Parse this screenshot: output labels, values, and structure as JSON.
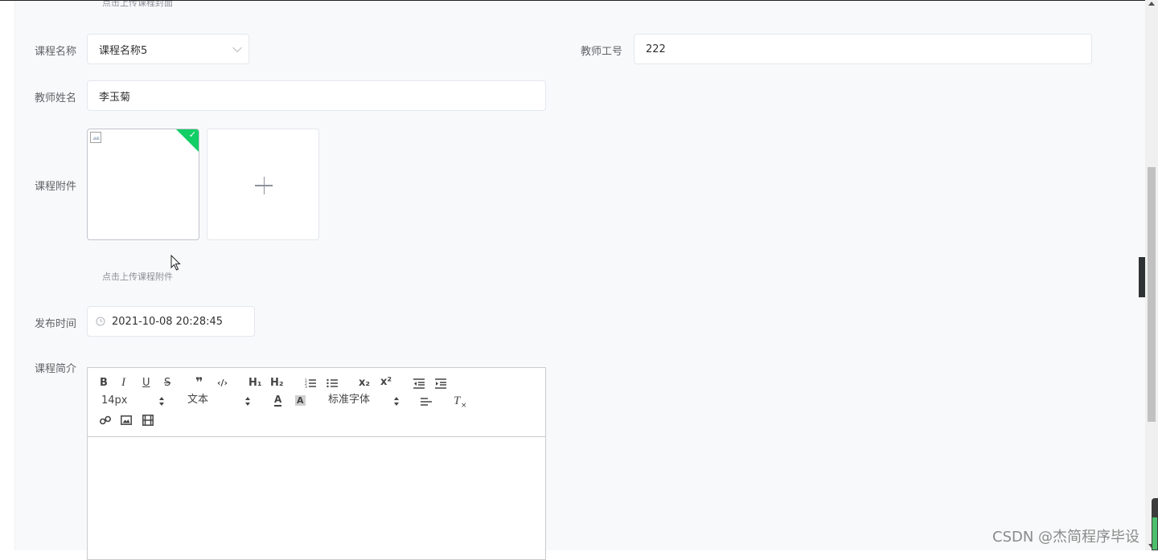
{
  "form": {
    "cover_tip": "点击上传课程封面",
    "course_name": {
      "label": "课程名称",
      "value": "课程名称5"
    },
    "teacher_id": {
      "label": "教师工号",
      "value": "222"
    },
    "teacher_name": {
      "label": "教师姓名",
      "value": "李玉菊"
    },
    "attachment": {
      "label": "课程附件",
      "tip": "点击上传课程附件"
    },
    "publish_time": {
      "label": "发布时间",
      "value": "2021-10-08 20:28:45"
    },
    "intro": {
      "label": "课程简介"
    }
  },
  "editor": {
    "toolbar": {
      "bold": "B",
      "italic": "I",
      "underline": "U",
      "strike": "S",
      "quote": "❞",
      "code": "‹/›",
      "h1": "H₁",
      "h2": "H₂",
      "subscript": "x₂",
      "superscript": "x²",
      "font_size": "14px",
      "header_select": "文本",
      "font_family": "标准字体",
      "font_color": "A",
      "bg_color": "A",
      "clean": "T"
    }
  },
  "sidebar_toggle": {
    "icon": "chevron-left-icon",
    "glyph": "‹"
  },
  "watermark": "CSDN @杰简程序毕设",
  "colors": {
    "success": "#13ce66",
    "border": "#e4e7ed",
    "text": "#606266"
  }
}
